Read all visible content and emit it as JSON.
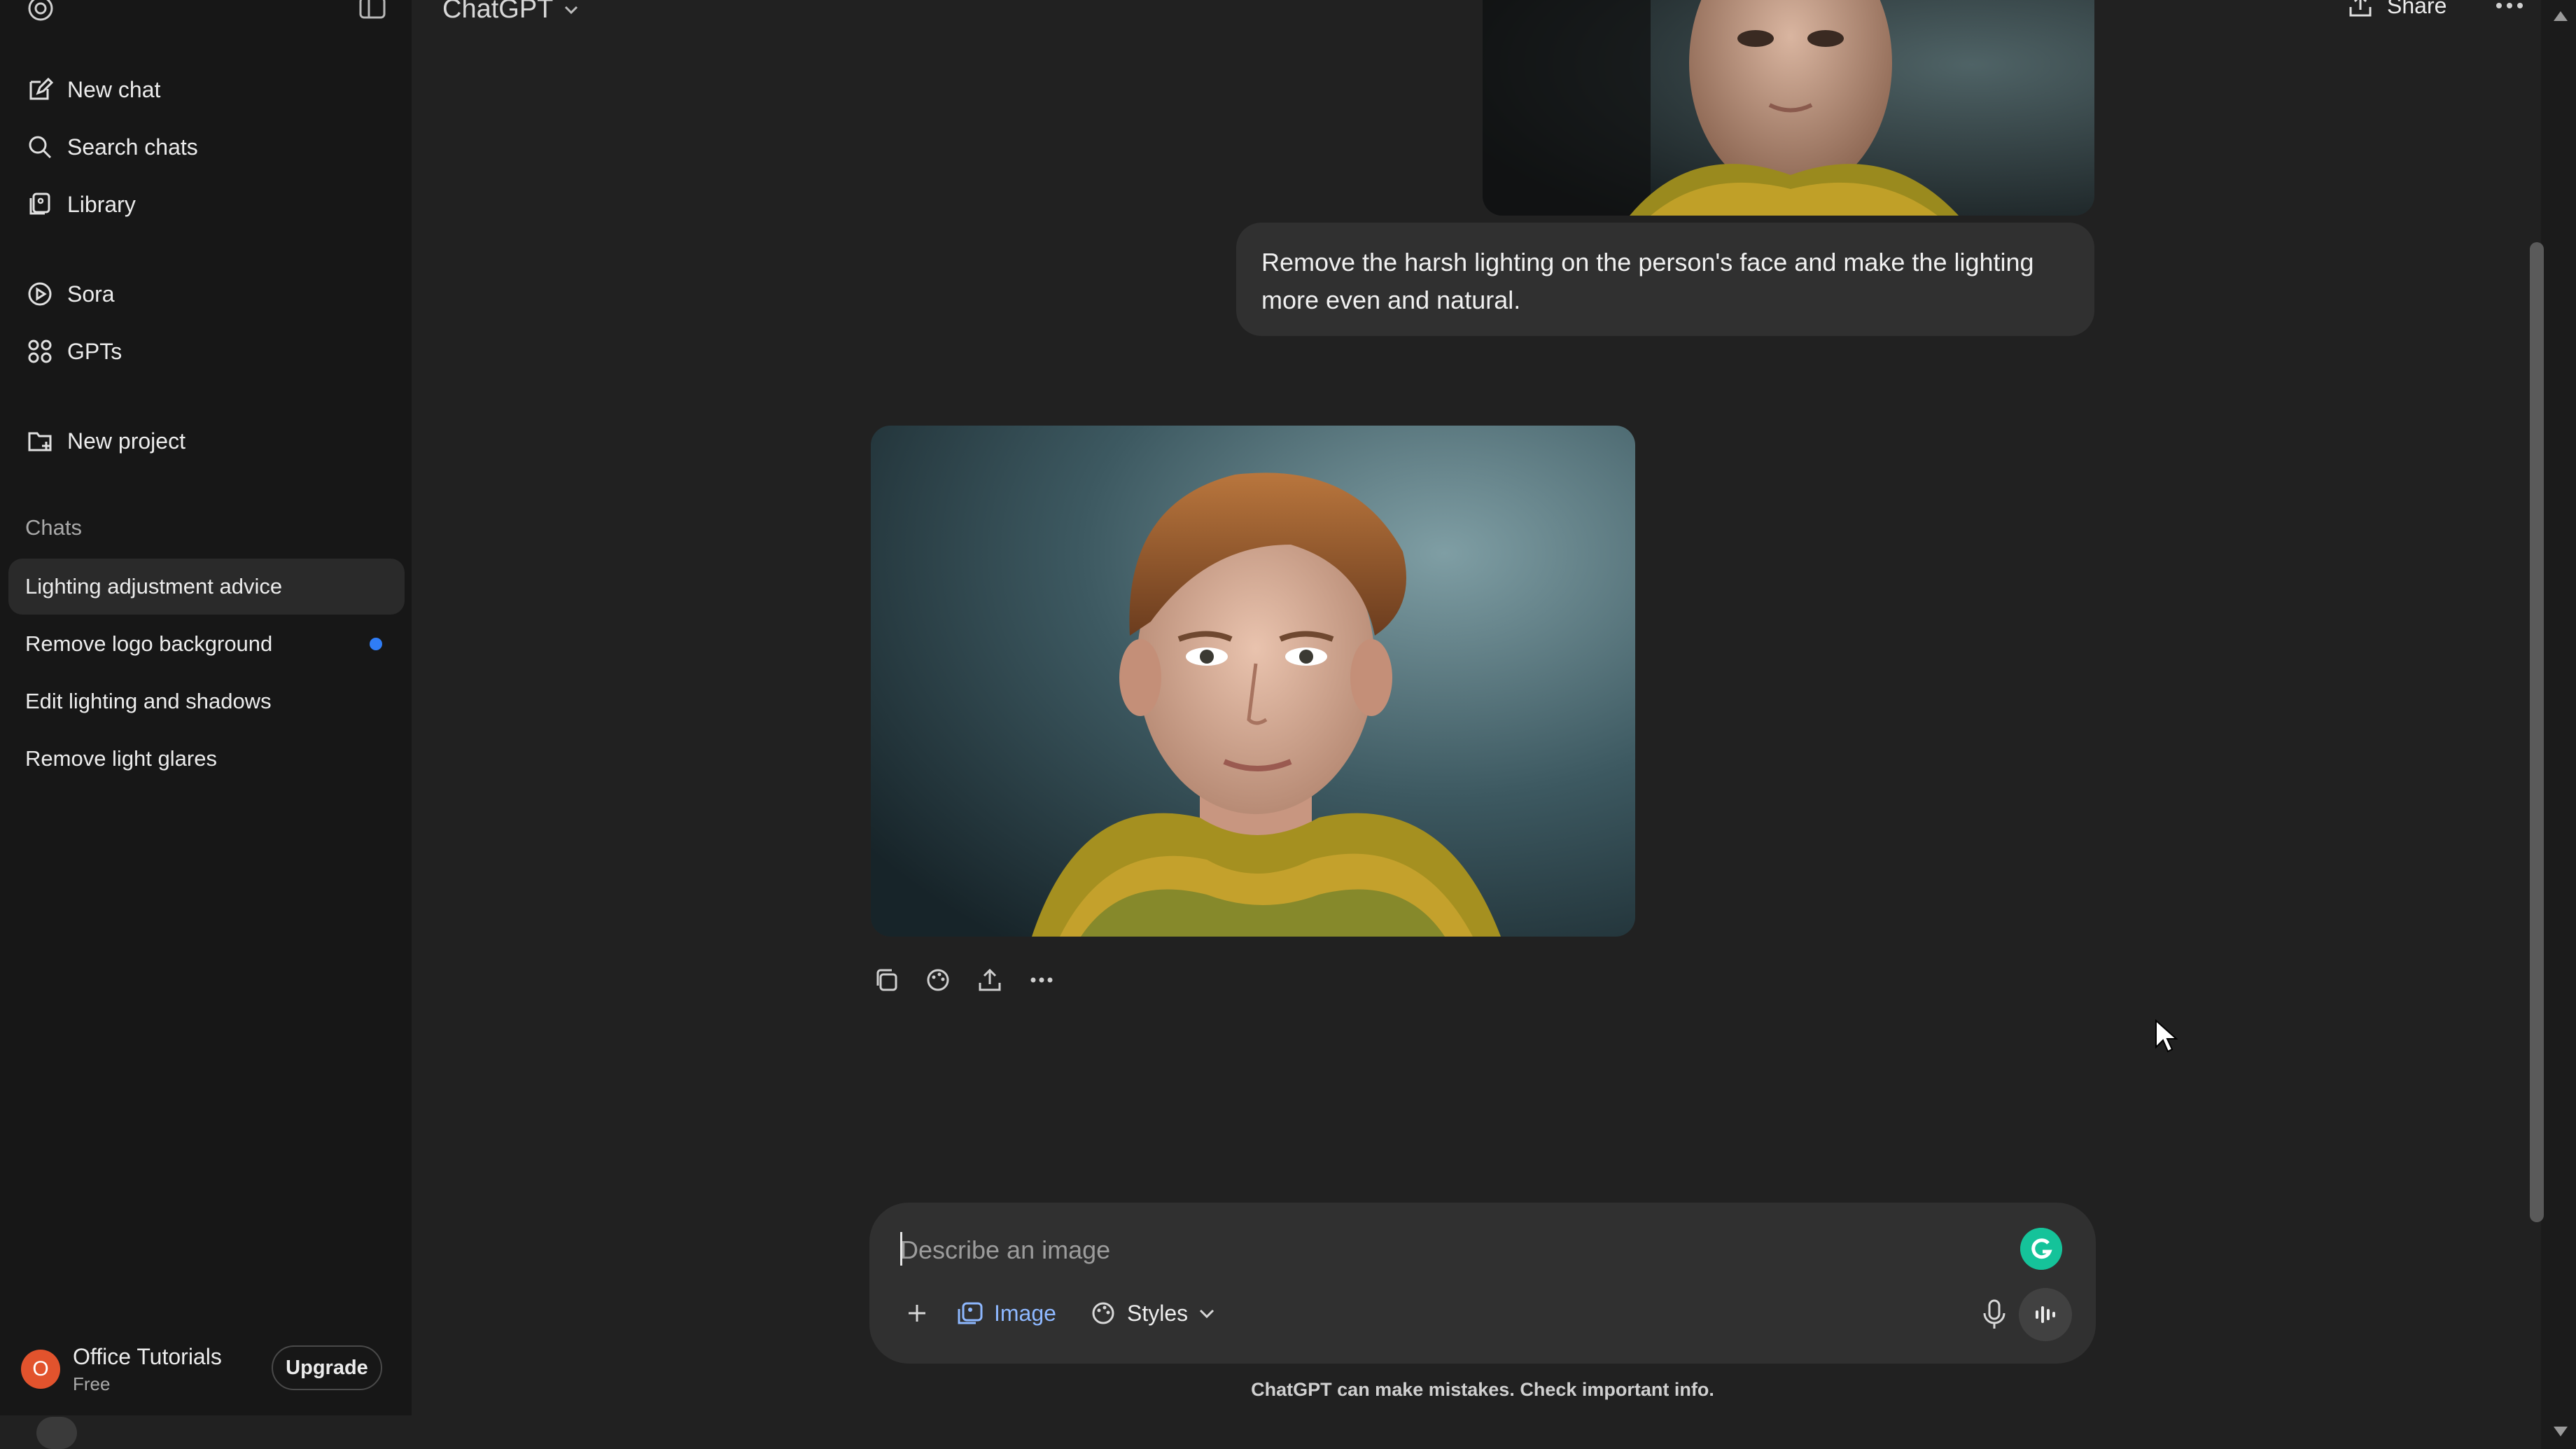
{
  "app": {
    "title": "ChatGPT"
  },
  "header": {
    "title": "ChatGPT",
    "share_label": "Share"
  },
  "sidebar": {
    "nav": [
      {
        "label": "New chat",
        "icon": "edit-icon"
      },
      {
        "label": "Search chats",
        "icon": "search-icon"
      },
      {
        "label": "Library",
        "icon": "library-icon"
      },
      {
        "label": "Sora",
        "icon": "play-circle-icon"
      },
      {
        "label": "GPTs",
        "icon": "grid-icon"
      },
      {
        "label": "New project",
        "icon": "folder-plus-icon"
      }
    ],
    "section_label": "Chats",
    "chats": [
      {
        "label": "Lighting adjustment advice",
        "active": true,
        "unread": false
      },
      {
        "label": "Remove logo background",
        "active": false,
        "unread": true
      },
      {
        "label": "Edit lighting and shadows",
        "active": false,
        "unread": false
      },
      {
        "label": "Remove light glares",
        "active": false,
        "unread": false
      }
    ],
    "user": {
      "initial": "O",
      "name": "Office Tutorials",
      "plan": "Free",
      "upgrade_label": "Upgrade"
    }
  },
  "conversation": {
    "user_message": "Remove the harsh lighting on the person's face and make the lighting more even and natural."
  },
  "composer": {
    "placeholder": "Describe an image",
    "image_label": "Image",
    "styles_label": "Styles"
  },
  "footer": {
    "disclaimer": "ChatGPT can make mistakes. Check important info."
  },
  "colors": {
    "accent": "#2f7df6",
    "avatar": "#e2532d",
    "grammarly": "#15c39a",
    "image_tool": "#8eb8ff"
  }
}
